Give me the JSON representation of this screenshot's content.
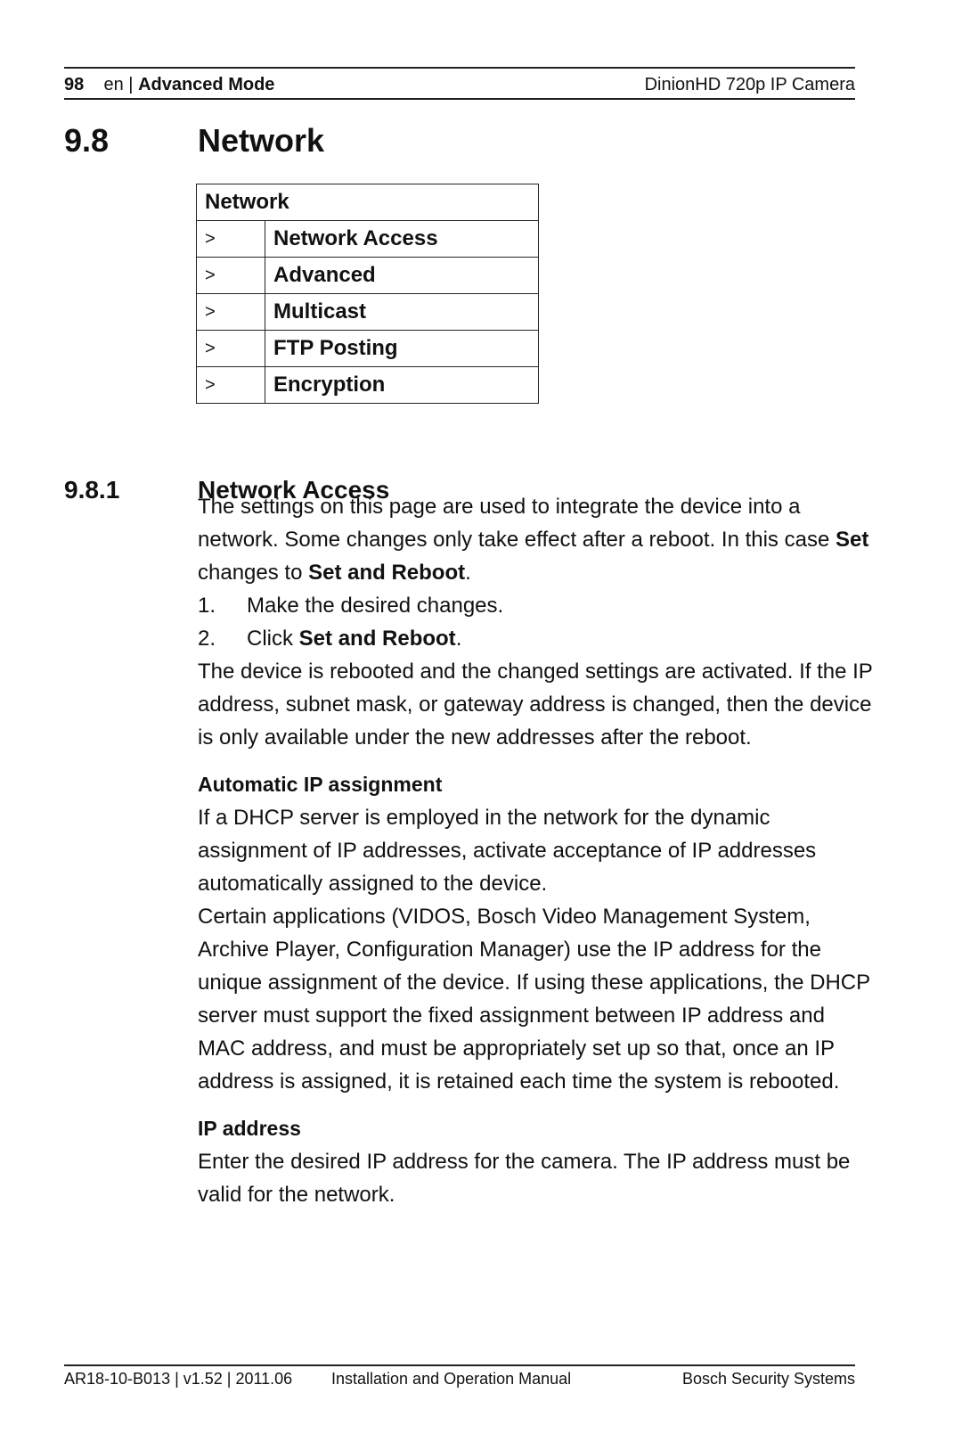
{
  "header": {
    "page_number": "98",
    "language": "en",
    "separator": "|",
    "chapter": "Advanced Mode",
    "product": "DinionHD 720p IP Camera"
  },
  "section": {
    "number": "9.8",
    "title": "Network"
  },
  "menu_table": {
    "title": "Network",
    "items": [
      {
        "arrow": ">",
        "label": "Network Access"
      },
      {
        "arrow": ">",
        "label": "Advanced"
      },
      {
        "arrow": ">",
        "label": "Multicast"
      },
      {
        "arrow": ">",
        "label": "FTP Posting"
      },
      {
        "arrow": ">",
        "label": "Encryption"
      }
    ]
  },
  "subsection": {
    "number": "9.8.1",
    "title": "Network Access",
    "intro": {
      "text1": "The settings on this page are used to integrate the device into a network. Some changes only take effect after a reboot. In this case ",
      "bold1": "Set",
      "text2": " changes to ",
      "bold2": "Set and Reboot",
      "text3": "."
    },
    "steps": [
      {
        "num": "1.",
        "text": "Make the desired changes.",
        "bold": "",
        "suffix": ""
      },
      {
        "num": "2.",
        "text": "Click ",
        "bold": "Set and Reboot",
        "suffix": "."
      }
    ],
    "after_steps": "The device is rebooted and the changed settings are activated. If the IP address, subnet mask, or gateway address is changed, then the device is only available under the new addresses after the reboot.",
    "automatic_ip": {
      "heading": "Automatic IP assignment",
      "para1": "If a DHCP server is employed in the network for the dynamic assignment of IP addresses, activate acceptance of IP addresses automatically assigned to the device.",
      "para2": "Certain applications (VIDOS, Bosch Video Management System, Archive Player, Configuration Manager) use the IP address for the unique assignment of the device. If using these applications, the DHCP server must support the fixed assignment between IP address and MAC address, and must be appropriately set up so that, once an IP address is assigned, it is retained each time the system is rebooted."
    },
    "ip_address": {
      "heading": "IP address",
      "para": "Enter the desired IP address for the camera. The IP address must be valid for the network."
    }
  },
  "footer": {
    "doc_info": "AR18-10-B013 | v1.52 | 2011.06",
    "manual": "Installation and Operation Manual",
    "company": "Bosch Security Systems"
  }
}
